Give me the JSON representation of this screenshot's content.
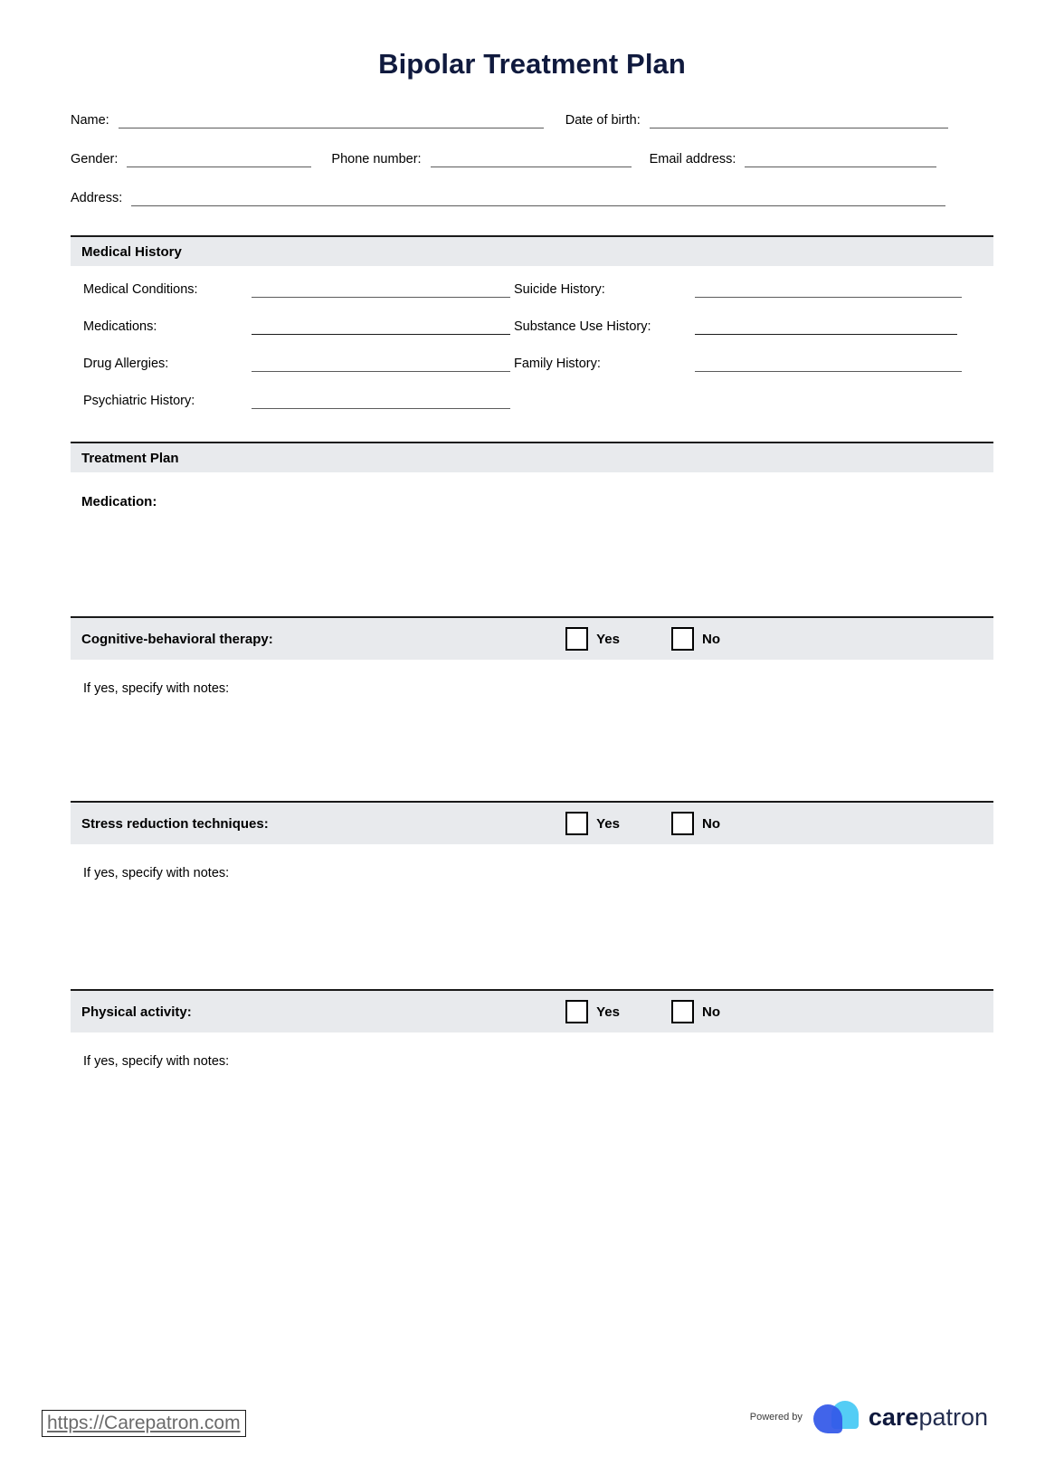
{
  "document": {
    "title": "Bipolar Treatment Plan"
  },
  "patient_info": {
    "rows": [
      [
        {
          "label": "Name:",
          "value": ""
        },
        {
          "label": "Date of birth:",
          "value": ""
        }
      ],
      [
        {
          "label": "Gender:",
          "value": ""
        },
        {
          "label": "Phone number:",
          "value": ""
        },
        {
          "label": "Email address:",
          "value": ""
        }
      ],
      [
        {
          "label": "Address:",
          "value": ""
        }
      ]
    ],
    "name_label": "Name:",
    "dob_label": "Date of birth:",
    "gender_label": "Gender:",
    "phone_label": "Phone number:",
    "email_label": "Email address:",
    "address_label": "Address:"
  },
  "medical_history": {
    "section_title": "Medical History",
    "fields": [
      {
        "label": "Medical Conditions:",
        "value": ""
      },
      {
        "label": "Suicide History:",
        "value": ""
      },
      {
        "label": "Medications:",
        "value": ""
      },
      {
        "label": "Substance Use History:",
        "value": ""
      },
      {
        "label": "Drug Allergies:",
        "value": ""
      },
      {
        "label": "Family History:",
        "value": ""
      },
      {
        "label": "Psychiatric History:",
        "value": ""
      }
    ],
    "medical_conditions_label": "Medical Conditions:",
    "suicide_history_label": "Suicide History:",
    "medications_label": "Medications:",
    "substance_use_label": "Substance Use History:",
    "drug_allergies_label": "Drug Allergies:",
    "family_history_label": "Family History:",
    "psychiatric_history_label": "Psychiatric History:"
  },
  "treatment_plan": {
    "section_title": "Treatment Plan",
    "medication_label": "Medication:",
    "medication_value": "",
    "notes_label": "If yes, specify with notes:",
    "yes_label": "Yes",
    "no_label": "No",
    "items": [
      {
        "label": "Cognitive-behavioral therapy:",
        "yes": "Yes",
        "no": "No",
        "yes_checked": false,
        "no_checked": false,
        "notes_label": "If yes, specify with notes:",
        "notes_value": ""
      },
      {
        "label": "Stress reduction techniques:",
        "yes": "Yes",
        "no": "No",
        "yes_checked": false,
        "no_checked": false,
        "notes_label": "If yes, specify with notes:",
        "notes_value": ""
      },
      {
        "label": "Physical activity:",
        "yes": "Yes",
        "no": "No",
        "yes_checked": false,
        "no_checked": false,
        "notes_label": "If yes, specify with notes:",
        "notes_value": ""
      }
    ]
  },
  "footer": {
    "url": "https://Carepatron.com",
    "powered_by": "Powered by",
    "brand_bold": "care",
    "brand_light": "patron"
  },
  "colors": {
    "title": "#101a3e",
    "section_bar_bg": "#e8eaed",
    "section_bar_border": "#1a1a1a",
    "rule": "#5b5b5b",
    "logo_blue": "#3358e8",
    "logo_cyan": "#54cdf5",
    "url_text": "#6b6b6b"
  }
}
